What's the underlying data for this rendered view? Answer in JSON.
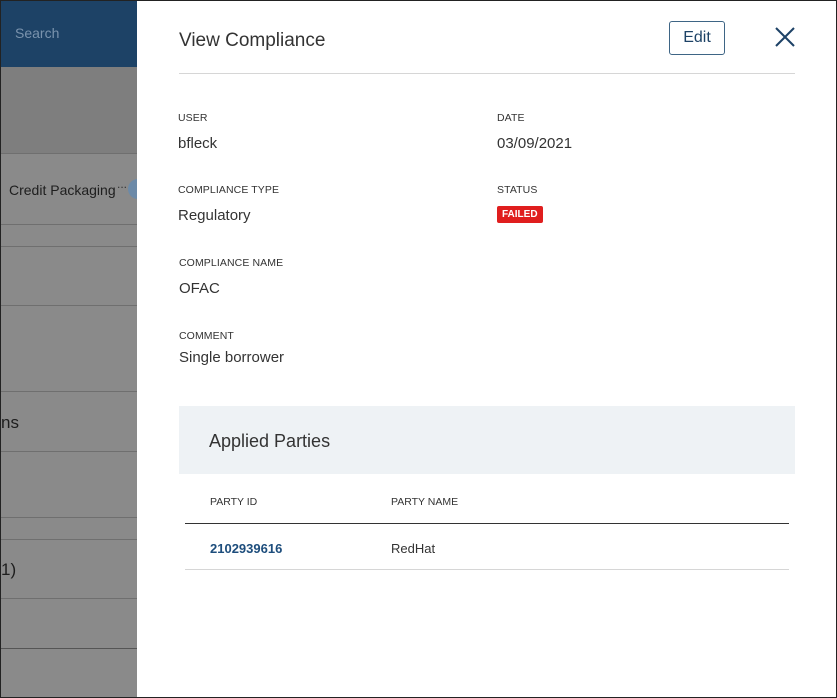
{
  "background": {
    "search_placeholder": "Search",
    "credit_packaging": "Credit Packaging",
    "fragment_ns": "ns",
    "fragment_paren": "1)",
    "ellipsis": "..."
  },
  "panel": {
    "title": "View Compliance",
    "edit_label": "Edit",
    "close_icon": "close-icon"
  },
  "fields": {
    "user_label": "USER",
    "user_value": "bfleck",
    "date_label": "DATE",
    "date_value": "03/09/2021",
    "compliance_type_label": "COMPLIANCE TYPE",
    "compliance_type_value": "Regulatory",
    "status_label": "STATUS",
    "status_value": "FAILED",
    "compliance_name_label": "COMPLIANCE NAME",
    "compliance_name_value": "OFAC",
    "comment_label": "COMMENT",
    "comment_value": "Single borrower"
  },
  "applied_parties": {
    "title": "Applied Parties",
    "columns": [
      "PARTY ID",
      "PARTY NAME"
    ],
    "rows": [
      {
        "party_id": "2102939616",
        "party_name": "RedHat"
      }
    ]
  },
  "colors": {
    "accent": "#1d4266",
    "status_failed": "#e01e1e",
    "link": "#1d4d7c"
  }
}
